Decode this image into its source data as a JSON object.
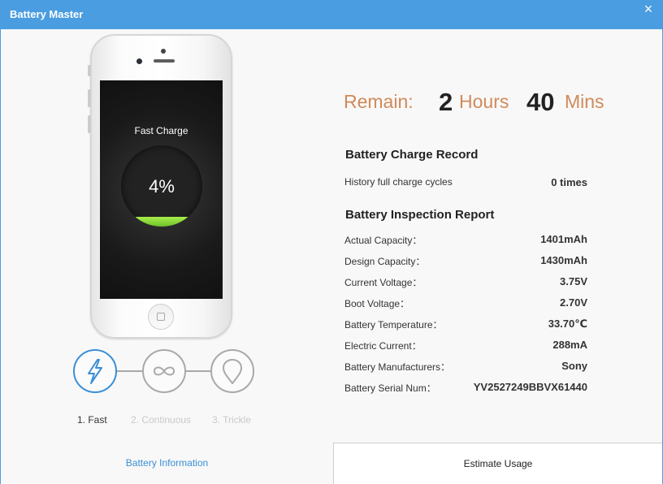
{
  "app": {
    "title": "Battery Master",
    "close_glyph": "×"
  },
  "phone": {
    "charge_mode_label": "Fast Charge",
    "percent_text": "4%",
    "percent_level": 0.04
  },
  "modes": [
    {
      "label": "1. Fast",
      "icon": "lightning-icon",
      "active": true
    },
    {
      "label": "2. Continuous",
      "icon": "infinity-icon",
      "active": false
    },
    {
      "label": "3. Trickle",
      "icon": "leaf-icon",
      "active": false
    }
  ],
  "remain": {
    "label": "Remain:",
    "hours": "2",
    "hours_unit": "Hours",
    "mins": "40",
    "mins_unit": "Mins"
  },
  "charge_record": {
    "title": "Battery Charge Record",
    "rows": [
      {
        "label": "History full charge cycles",
        "value": "0 times"
      }
    ]
  },
  "inspection": {
    "title": "Battery Inspection Report",
    "rows": [
      {
        "label": "Actual  Capacity：",
        "value": "1401mAh"
      },
      {
        "label": "Design  Capacity：",
        "value": "1430mAh"
      },
      {
        "label": "Current  Voltage：",
        "value": "3.75V"
      },
      {
        "label": "Boot  Voltage：",
        "value": "2.70V"
      },
      {
        "label": "Battery  Temperature：",
        "value": "33.70℃"
      },
      {
        "label": "Electric  Current：",
        "value": "288mA"
      },
      {
        "label": "Battery  Manufacturers：",
        "value": "Sony"
      },
      {
        "label": "Battery  Serial  Num：",
        "value": "YV2527249BBVX61440"
      }
    ]
  },
  "tabs": {
    "info": "Battery Information",
    "usage": "Estimate Usage"
  },
  "colors": {
    "accent": "#4a9de0",
    "remain": "#d08a5a",
    "charge": "#8fdc3a"
  }
}
